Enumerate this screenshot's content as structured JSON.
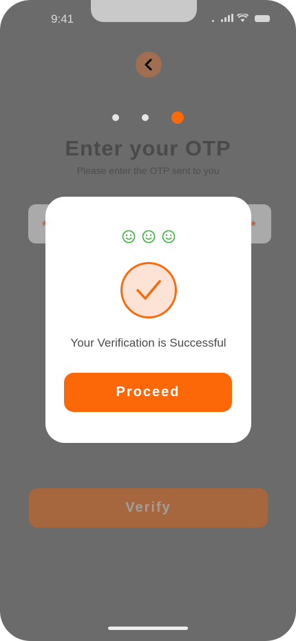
{
  "status_bar": {
    "time": "9:41"
  },
  "header": {
    "title": "Enter your OTP",
    "subtitle": "Please enter the OTP sent to you"
  },
  "steps": {
    "total": 3,
    "active_index": 2
  },
  "otp": {
    "placeholder_char": "*"
  },
  "modal": {
    "message": "Your Verification is Successful",
    "proceed_label": "Proceed"
  },
  "footer": {
    "verify_label": "Verify"
  },
  "colors": {
    "accent": "#fc6707",
    "success_green": "#2fb52f",
    "overlay": "#6b6b6b"
  }
}
